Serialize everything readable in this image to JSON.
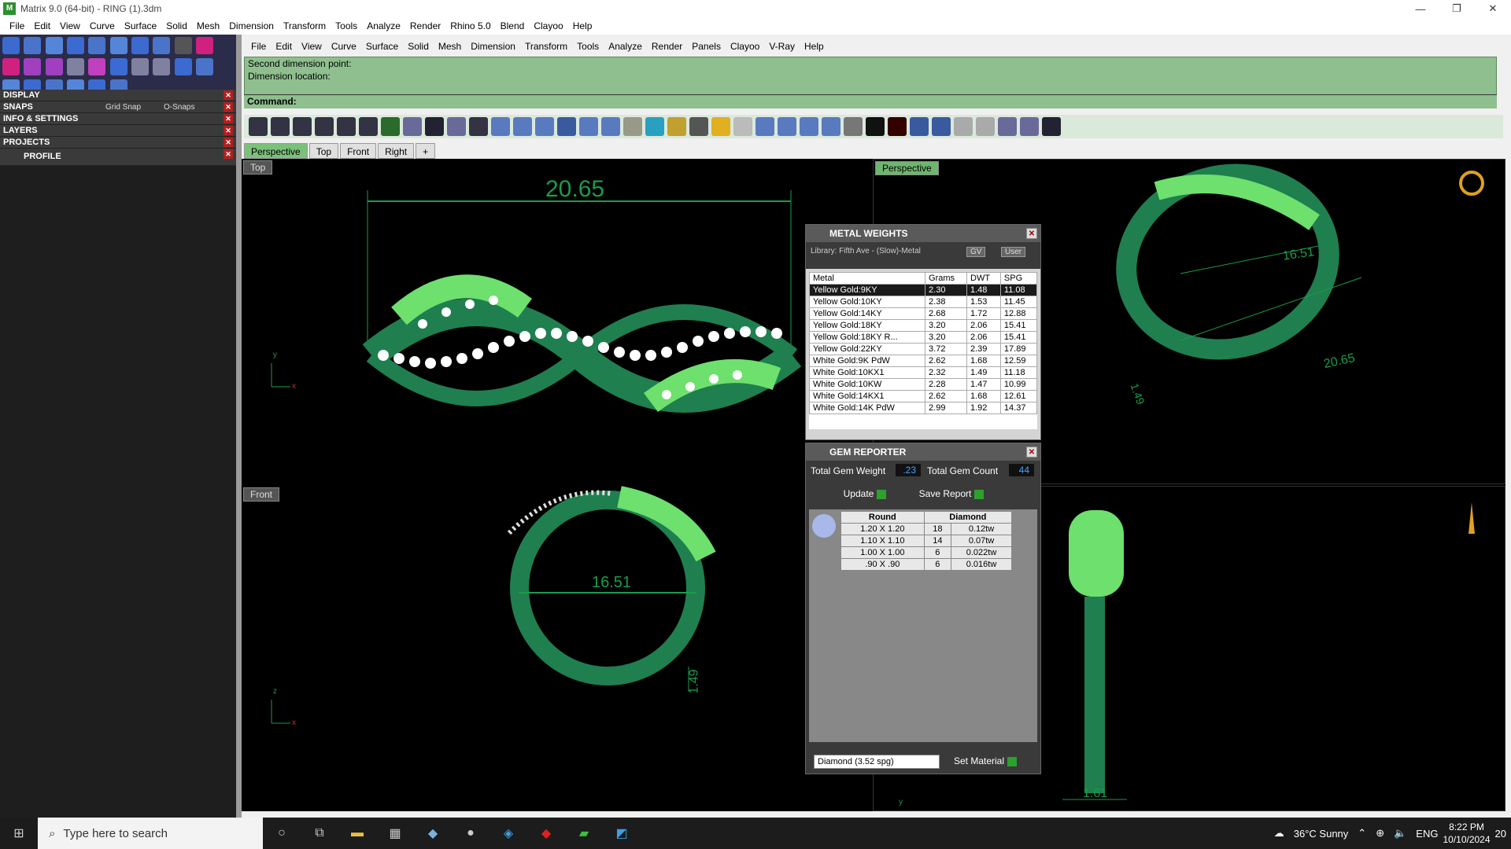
{
  "window": {
    "title": "Matrix 9.0 (64-bit) - RING (1).3dm",
    "minimize": "—",
    "restore": "❐",
    "close": "✕"
  },
  "menu": [
    "File",
    "Edit",
    "View",
    "Curve",
    "Surface",
    "Solid",
    "Mesh",
    "Dimension",
    "Transform",
    "Tools",
    "Analyze",
    "Render",
    "Rhino 5.0",
    "Blend",
    "Clayoo",
    "Help"
  ],
  "menu2": [
    "File",
    "Edit",
    "View",
    "Curve",
    "Surface",
    "Solid",
    "Mesh",
    "Dimension",
    "Transform",
    "Tools",
    "Analyze",
    "Render",
    "Panels",
    "Clayoo",
    "V-Ray",
    "Help"
  ],
  "left": {
    "display": "DISPLAY",
    "snaps": "SNAPS",
    "grid_snap": "Grid Snap",
    "o_snaps": "O-Snaps",
    "info": "INFO & SETTINGS",
    "layers": "LAYERS",
    "projects": "PROJECTS",
    "profile": "PROFILE"
  },
  "command": {
    "line1": "Second dimension point:",
    "line2": "Dimension location:",
    "prompt": "Command:"
  },
  "tabs": [
    "Perspective",
    "Top",
    "Front",
    "Right",
    "+"
  ],
  "viewports": {
    "top": {
      "label": "Top",
      "dim": "20.65",
      "x": "x",
      "y": "y"
    },
    "perspective": {
      "label": "Perspective",
      "dim1": "16.51",
      "dim2": "20.65",
      "dim3": "1.49"
    },
    "front": {
      "label": "Front",
      "dim": "16.51",
      "dim2": "1.49",
      "x": "x",
      "z": "z"
    },
    "right": {
      "dim": "1.61",
      "y": "y"
    }
  },
  "metal_weights": {
    "title": "METAL WEIGHTS",
    "library": "Library: Fifth Ave - (Slow)-Metal",
    "gv": "GV",
    "user": "User",
    "headers": [
      "Metal",
      "Grams",
      "DWT",
      "SPG"
    ],
    "rows": [
      [
        "Yellow Gold:9KY",
        "2.30",
        "1.48",
        "11.08"
      ],
      [
        "Yellow Gold:10KY",
        "2.38",
        "1.53",
        "11.45"
      ],
      [
        "Yellow Gold:14KY",
        "2.68",
        "1.72",
        "12.88"
      ],
      [
        "Yellow Gold:18KY",
        "3.20",
        "2.06",
        "15.41"
      ],
      [
        "Yellow Gold:18KY R...",
        "3.20",
        "2.06",
        "15.41"
      ],
      [
        "Yellow Gold:22KY",
        "3.72",
        "2.39",
        "17.89"
      ],
      [
        "White Gold:9K PdW",
        "2.62",
        "1.68",
        "12.59"
      ],
      [
        "White Gold:10KX1",
        "2.32",
        "1.49",
        "11.18"
      ],
      [
        "White Gold:10KW",
        "2.28",
        "1.47",
        "10.99"
      ],
      [
        "White Gold:14KX1",
        "2.62",
        "1.68",
        "12.61"
      ],
      [
        "White Gold:14K PdW",
        "2.99",
        "1.92",
        "14.37"
      ]
    ]
  },
  "gem_reporter": {
    "title": "GEM REPORTER",
    "total_weight_label": "Total Gem Weight",
    "total_weight": ".23",
    "total_count_label": "Total Gem Count",
    "total_count": "44",
    "update": "Update",
    "save_report": "Save Report",
    "headers": [
      "Round",
      "Diamond"
    ],
    "rows": [
      [
        "1.20 X 1.20",
        "18",
        "0.12tw"
      ],
      [
        "1.10 X 1.10",
        "14",
        "0.07tw"
      ],
      [
        "1.00 X 1.00",
        "6",
        "0.022tw"
      ],
      [
        ".90 X .90",
        "6",
        "0.016tw"
      ]
    ],
    "material": "Diamond    (3.52 spg)",
    "set_material": "Set Material"
  },
  "taskbar": {
    "search_placeholder": "Type here to search",
    "weather": "36°C  Sunny",
    "lang": "ENG",
    "time": "8:22 PM",
    "date": "10/10/2024",
    "notif": "20"
  }
}
